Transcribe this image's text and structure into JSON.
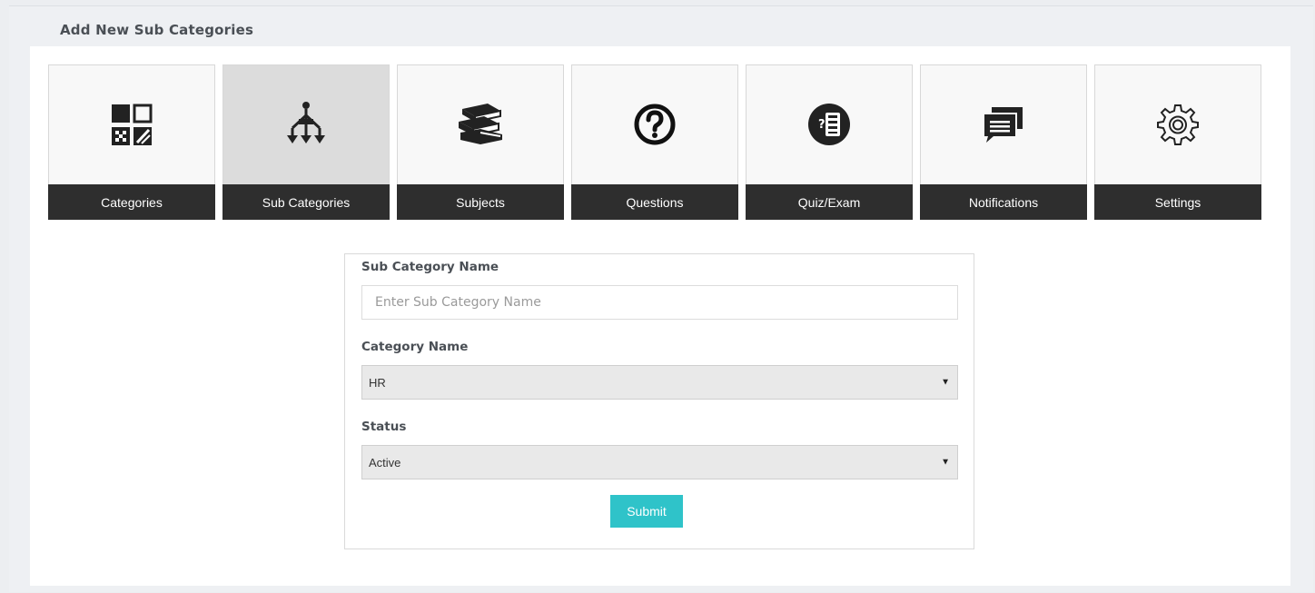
{
  "page": {
    "title": "Add New Sub Categories"
  },
  "tiles": [
    {
      "label": "Categories",
      "icon": "categories-grid-icon"
    },
    {
      "label": "Sub Categories",
      "icon": "hierarchy-icon",
      "active": true
    },
    {
      "label": "Subjects",
      "icon": "books-icon"
    },
    {
      "label": "Questions",
      "icon": "question-circle-icon"
    },
    {
      "label": "Quiz/Exam",
      "icon": "quiz-list-icon"
    },
    {
      "label": "Notifications",
      "icon": "chat-bubble-icon"
    },
    {
      "label": "Settings",
      "icon": "gear-icon"
    }
  ],
  "form": {
    "sub_category_label": "Sub Category Name",
    "sub_category_placeholder": "Enter Sub Category Name",
    "category_label": "Category Name",
    "category_value": "HR",
    "status_label": "Status",
    "status_value": "Active",
    "submit_label": "Submit"
  },
  "colors": {
    "accent": "#2fc3c9",
    "tile_bar": "#2e2e2e",
    "active_tile": "#dcdcdc"
  }
}
